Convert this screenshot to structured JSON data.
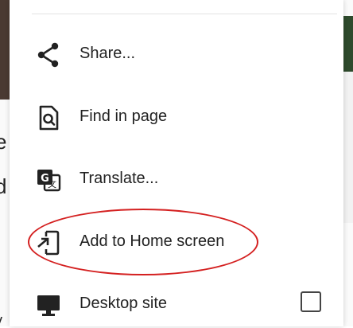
{
  "menu": {
    "items": [
      {
        "label": "Share...",
        "icon": "share-icon"
      },
      {
        "label": "Find in page",
        "icon": "find-in-page-icon"
      },
      {
        "label": "Translate...",
        "icon": "translate-icon"
      },
      {
        "label": "Add to Home screen",
        "icon": "add-to-home-screen-icon"
      },
      {
        "label": "Desktop site",
        "icon": "desktop-icon",
        "checked": false
      }
    ]
  },
  "background_page": {
    "fragments": [
      "e",
      "d",
      "(",
      "i",
      "v"
    ]
  },
  "colors": {
    "highlight_oval": "#d42020",
    "icon": "#222222"
  }
}
